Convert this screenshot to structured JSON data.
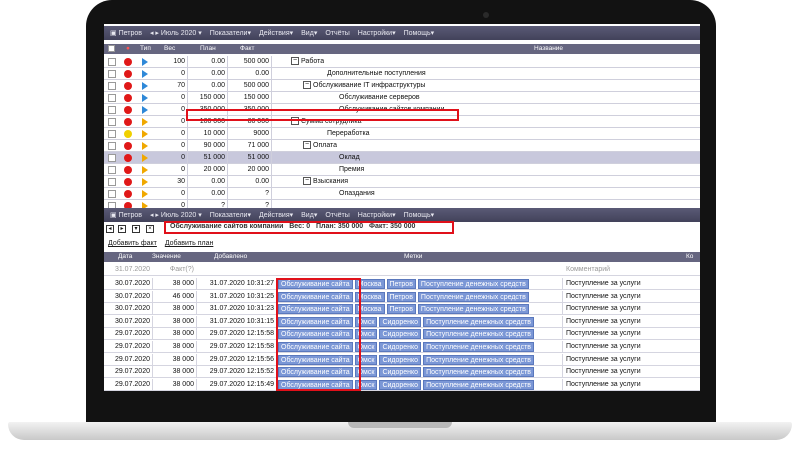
{
  "toolbar": {
    "user": "Петров",
    "period": "Июль 2020",
    "menus": [
      "Показатели",
      "Действия",
      "Вид",
      "Отчёты",
      "Настройки",
      "Помощь"
    ]
  },
  "grid": {
    "columns": {
      "type": "Тип",
      "weight": "Вес",
      "plan": "План",
      "fact": "Факт",
      "name": "Название"
    },
    "rows": [
      {
        "weight": "100",
        "plan": "0.00",
        "fact": "500 000",
        "name": "Работа",
        "toggle": "−",
        "dot": "#e01818",
        "flag": "#2e88d8"
      },
      {
        "weight": "0",
        "plan": "0.00",
        "fact": "0.00",
        "name": "Дополнительные поступления",
        "toggle": "",
        "dot": "#e01818",
        "flag": "#2e88d8"
      },
      {
        "weight": "70",
        "plan": "0.00",
        "fact": "500 000",
        "name": "Обслуживание IT инфраструктуры",
        "toggle": "−",
        "dot": "#e01818",
        "flag": "#2e88d8"
      },
      {
        "weight": "0",
        "plan": "150 000",
        "fact": "150 000",
        "name": "Обслуживание серверов",
        "toggle": "",
        "dot": "#e01818",
        "flag": "#2e88d8"
      },
      {
        "weight": "0",
        "plan": "350 000",
        "fact": "350 000",
        "name": "Обслуживание сайтов компании",
        "toggle": "",
        "dot": "#e01818",
        "flag": "#2e88d8"
      },
      {
        "weight": "0",
        "plan": "100 000",
        "fact": "80 000",
        "name": "Сумма сотрудника",
        "toggle": "−",
        "dot": "#e01818",
        "flag": "#f0a800"
      },
      {
        "weight": "0",
        "plan": "10 000",
        "fact": "9000",
        "name": "Переработка",
        "toggle": "",
        "dot": "#f0d000",
        "flag": "#f0a800"
      },
      {
        "weight": "0",
        "plan": "90 000",
        "fact": "71 000",
        "name": "Оплата",
        "toggle": "−",
        "dot": "#e01818",
        "flag": "#f0a800"
      },
      {
        "weight": "0",
        "plan": "51 000",
        "fact": "51 000",
        "name": "Оклад",
        "toggle": "",
        "dot": "#e01818",
        "flag": "#f0a800"
      },
      {
        "weight": "0",
        "plan": "20 000",
        "fact": "20 000",
        "name": "Премия",
        "toggle": "",
        "dot": "#e01818",
        "flag": "#f0a800"
      },
      {
        "weight": "30",
        "plan": "0.00",
        "fact": "0.00",
        "name": "Взыскания",
        "toggle": "−",
        "dot": "#e01818",
        "flag": "#f0a800"
      },
      {
        "weight": "0",
        "plan": "0.00",
        "fact": "?",
        "name": "Опаздания",
        "toggle": "",
        "dot": "#e01818",
        "flag": "#f0a800"
      },
      {
        "weight": "0",
        "plan": "?",
        "fact": "?",
        "name": "",
        "toggle": "",
        "dot": "#e01818",
        "flag": "#f0a800"
      }
    ]
  },
  "info": {
    "title": "Обслуживание сайтов компании",
    "weight": "Вес: 0",
    "plan": "План: 350 000",
    "fact": "Факт: 350 000"
  },
  "links": {
    "add_fact": "Добавить факт",
    "add_plan": "Добавить план"
  },
  "facts": {
    "columns": {
      "date": "Дата",
      "value": "Значение",
      "added": "Добавлено",
      "tags": "Метки",
      "comment": "Ко"
    },
    "summary": {
      "date": "31.07.2020",
      "value": "Факт(?)",
      "comment": "Комментарий"
    },
    "rows": [
      {
        "date": "30.07.2020",
        "value": "38 000",
        "added": "31.07.2020 10:31:27",
        "tags": [
          "Обслуживание сайта",
          "Москва",
          "Петров",
          "Поступление денежных средств"
        ],
        "comment": "Поступление за услуги"
      },
      {
        "date": "30.07.2020",
        "value": "46 000",
        "added": "31.07.2020 10:31:25",
        "tags": [
          "Обслуживание сайта",
          "Москва",
          "Петров",
          "Поступление денежных средств"
        ],
        "comment": "Поступление за услуги"
      },
      {
        "date": "30.07.2020",
        "value": "38 000",
        "added": "31.07.2020 10:31:23",
        "tags": [
          "Обслуживание сайта",
          "Москва",
          "Петров",
          "Поступление денежных средств"
        ],
        "comment": "Поступление за услуги"
      },
      {
        "date": "30.07.2020",
        "value": "38 000",
        "added": "31.07.2020 10:31:15",
        "tags": [
          "Обслуживание сайта",
          "Омск",
          "Сидоренко",
          "Поступление денежных средств"
        ],
        "comment": "Поступление за услуги"
      },
      {
        "date": "29.07.2020",
        "value": "38 000",
        "added": "29.07.2020 12:15:58",
        "tags": [
          "Обслуживание сайта",
          "Омск",
          "Сидоренко",
          "Поступление денежных средств"
        ],
        "comment": "Поступление за услуги"
      },
      {
        "date": "29.07.2020",
        "value": "38 000",
        "added": "29.07.2020 12:15:58",
        "tags": [
          "Обслуживание сайта",
          "Омск",
          "Сидоренко",
          "Поступление денежных средств"
        ],
        "comment": "Поступление за услуги"
      },
      {
        "date": "29.07.2020",
        "value": "38 000",
        "added": "29.07.2020 12:15:56",
        "tags": [
          "Обслуживание сайта",
          "Омск",
          "Сидоренко",
          "Поступление денежных средств"
        ],
        "comment": "Поступление за услуги"
      },
      {
        "date": "29.07.2020",
        "value": "38 000",
        "added": "29.07.2020 12:15:52",
        "tags": [
          "Обслуживание сайта",
          "Омск",
          "Сидоренко",
          "Поступление денежных средств"
        ],
        "comment": "Поступление за услуги"
      },
      {
        "date": "29.07.2020",
        "value": "38 000",
        "added": "29.07.2020 12:15:49",
        "tags": [
          "Обслуживание сайта",
          "Омск",
          "Сидоренко",
          "Поступление денежных средств"
        ],
        "comment": "Поступление за услуги"
      }
    ]
  },
  "colors": {
    "highlight": "#e0101a",
    "toolbar": "#4a4a64",
    "tag": "#7b97d6"
  }
}
